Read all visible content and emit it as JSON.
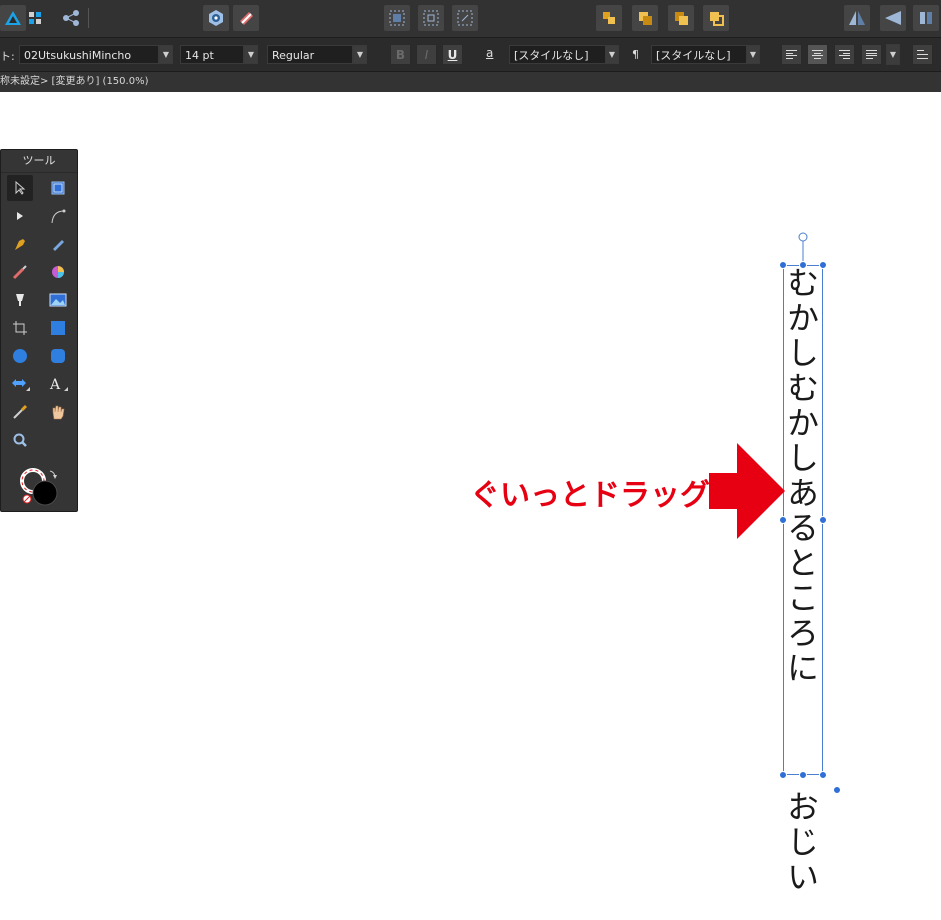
{
  "toolbar": {
    "buttons": [
      {
        "name": "affinity-designer-persona-icon"
      },
      {
        "name": "pixel-persona-icon"
      },
      {
        "name": "export-persona-icon"
      },
      {
        "name": "assistant-icon"
      },
      {
        "name": "snapping-icon"
      },
      {
        "name": "insert-inside-icon"
      },
      {
        "name": "insert-behind-icon"
      },
      {
        "name": "insert-top-icon"
      },
      {
        "name": "move-back-icon"
      },
      {
        "name": "move-forward-icon"
      },
      {
        "name": "move-front-icon"
      },
      {
        "name": "move-top-icon"
      },
      {
        "name": "flip-horizontal-icon"
      },
      {
        "name": "flip-vertical-icon"
      },
      {
        "name": "rotate-icon"
      }
    ]
  },
  "format": {
    "font_label": "ト:",
    "font_family": "02UtsukushiMincho",
    "font_size": "14 pt",
    "font_style": "Regular",
    "bold": "B",
    "italic": "I",
    "underline": "U",
    "char_style_icon_label": "a",
    "char_style": "[スタイルなし]",
    "para_style_icon_label": "¶",
    "para_style": "[スタイルなし]"
  },
  "status": {
    "text": "称未設定> [変更あり] (150.0%)"
  },
  "tools_panel": {
    "title": "ツール",
    "tools": [
      "move-tool-icon",
      "artboard-tool-icon",
      "node-tool-icon",
      "corner-tool-icon",
      "pen-tool-icon",
      "pencil-tool-icon",
      "vector-brush-tool-icon",
      "fill-tool-icon",
      "transparency-tool-icon",
      "place-image-tool-icon",
      "crop-tool-icon",
      "rectangle-tool-icon",
      "ellipse-tool-icon",
      "rounded-rectangle-tool-icon",
      "flow-tool-icon",
      "artistic-text-tool-icon",
      "color-picker-tool-icon",
      "view-tool-icon",
      "zoom-tool-icon"
    ]
  },
  "canvas": {
    "vertical_text_in_frame": "むかしむかしあるところに",
    "vertical_text_overflow": "おじい",
    "annotation": "ぐいっとドラッグ",
    "accent_color": "#e60012",
    "selection_color": "#2f6fd6"
  }
}
